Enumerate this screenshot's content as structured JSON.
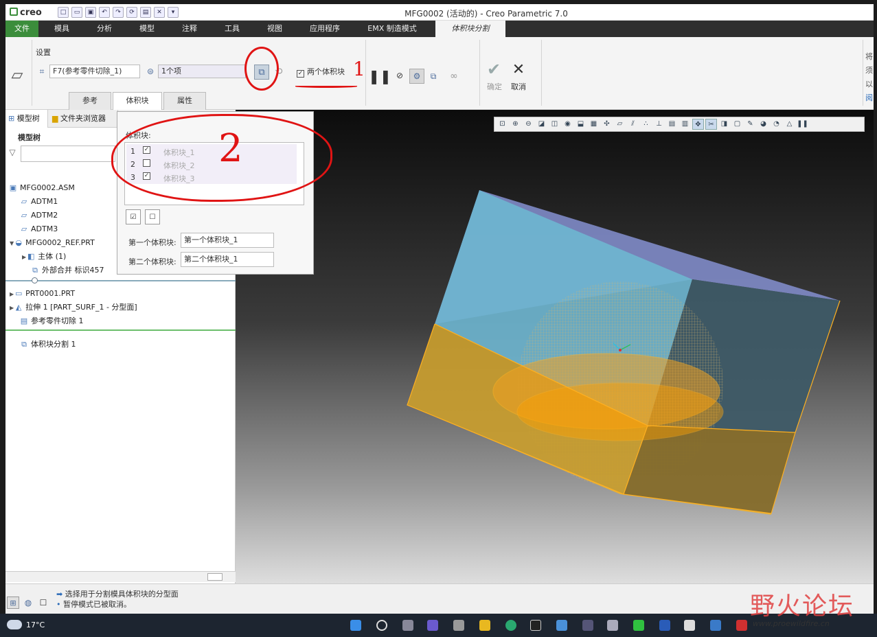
{
  "app": {
    "logo": "creo",
    "title": "MFG0002 (活动的) - Creo Parametric 7.0"
  },
  "ribbon_tabs": [
    "文件",
    "模具",
    "分析",
    "模型",
    "注释",
    "工具",
    "视图",
    "应用程序",
    "EMX 制造模式",
    "体积块分割"
  ],
  "settings": {
    "group_label": "设置",
    "reference_field": "F7(参考零件切除_1)",
    "items_field": "1个项",
    "two_volumes_label": "两个体积块"
  },
  "actions": {
    "ok_label": "确定",
    "cancel_label": "取消"
  },
  "subtabs": [
    "参考",
    "体积块",
    "属性"
  ],
  "right_edge_text": [
    "将",
    "须",
    "以",
    "阅"
  ],
  "panel": {
    "tabs": [
      "模型树",
      "文件夹浏览器"
    ],
    "tree_header": "模型树",
    "tree": [
      {
        "label": "MFG0002.ASM",
        "icon": "assembly-icon"
      },
      {
        "label": "ADTM1",
        "icon": "datum-plane-icon"
      },
      {
        "label": "ADTM2",
        "icon": "datum-plane-icon"
      },
      {
        "label": "ADTM3",
        "icon": "datum-plane-icon"
      },
      {
        "label": "MFG0002_REF.PRT",
        "icon": "part-icon"
      },
      {
        "label": "主体 (1)",
        "icon": "body-icon"
      },
      {
        "label": "外部合并 标识457",
        "icon": "merge-icon"
      },
      {
        "label": "PRT0001.PRT",
        "icon": "part-icon"
      },
      {
        "label": "拉伸 1 [PART_SURF_1 - 分型面]",
        "icon": "extrude-icon"
      },
      {
        "label": "参考零件切除 1",
        "icon": "cutout-icon"
      },
      {
        "label": "体积块分割 1",
        "icon": "volume-split-icon"
      }
    ]
  },
  "popup": {
    "title": "体积块:",
    "rows": [
      {
        "num": "1",
        "checked": true,
        "name": "体积块_1"
      },
      {
        "num": "2",
        "checked": false,
        "name": "体积块_2"
      },
      {
        "num": "3",
        "checked": true,
        "name": "体积块_3"
      }
    ],
    "first_label": "第一个体积块:",
    "first_value": "第一个体积块_1",
    "second_label": "第二个体积块:",
    "second_value": "第二个体积块_1"
  },
  "annotations": {
    "one": "1",
    "two": "2"
  },
  "status": {
    "line1": "选择用于分割模具体积块的分型面",
    "line2": "暂停模式已被取消。"
  },
  "taskbar": {
    "weather": "17°C"
  },
  "watermark": {
    "brand": "野火论坛",
    "url": "www.proewildfire.cn"
  },
  "colors": {
    "file_tab": "#3b8d3b",
    "annotation_red": "#e01414",
    "volume_orange": "#f0a020",
    "box_blue": "#6eb6d0"
  }
}
